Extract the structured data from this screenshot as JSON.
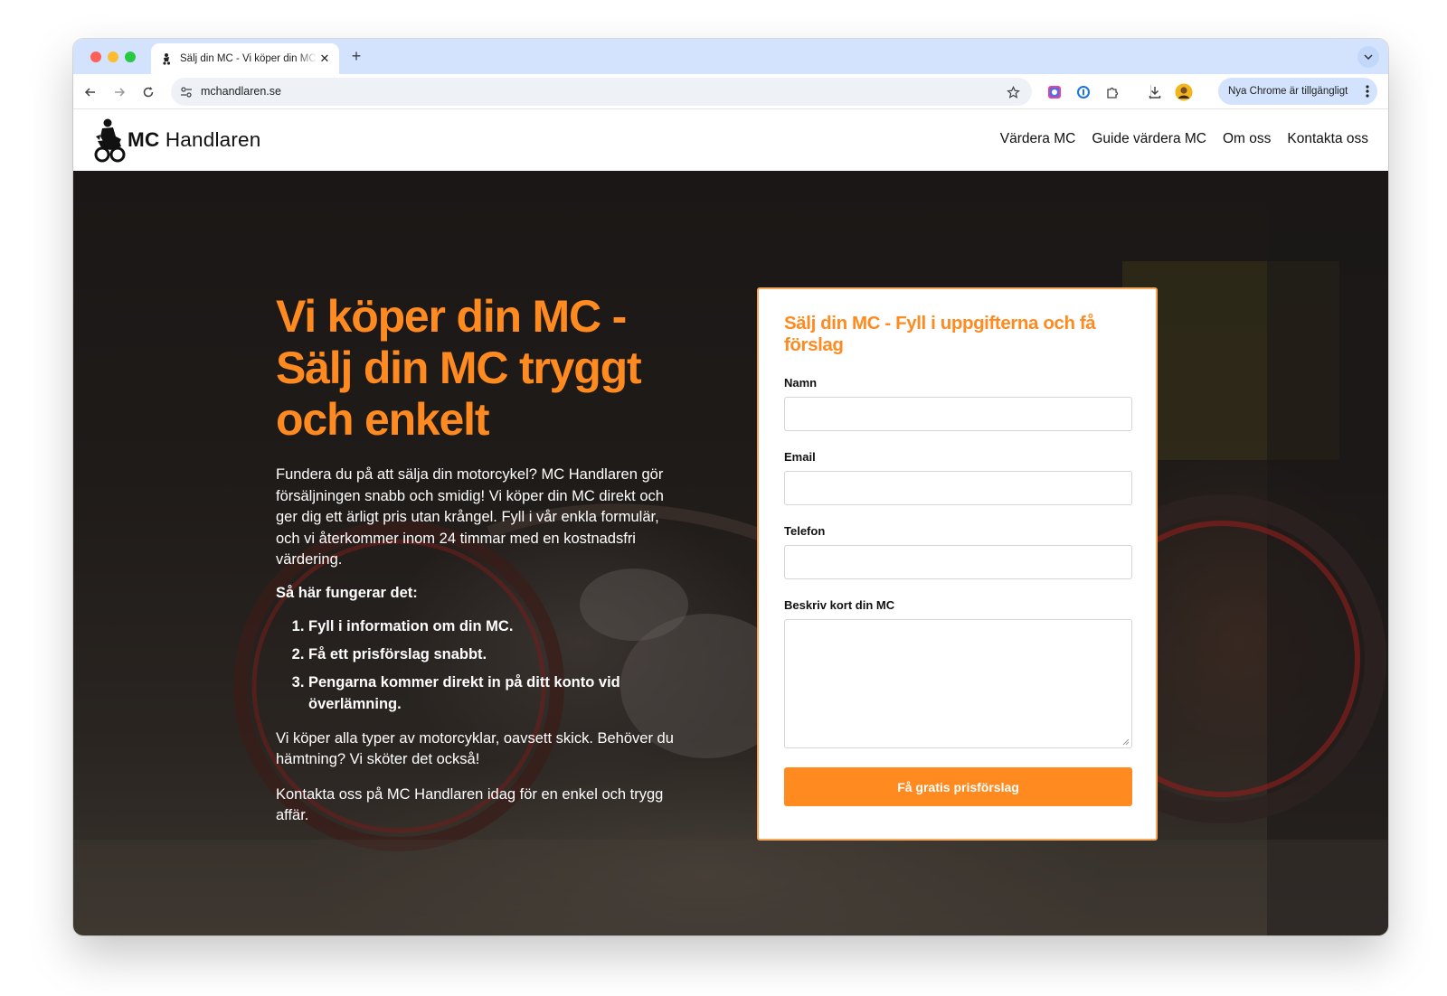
{
  "browser": {
    "tab_title": "Sälj din MC - Vi köper din MC",
    "url": "mchandlaren.se",
    "update_label": "Nya Chrome är tillgängligt"
  },
  "site": {
    "logo_bold": "MC",
    "logo_light": "Handlaren",
    "nav": [
      "Värdera MC",
      "Guide värdera MC",
      "Om oss",
      "Kontakta oss"
    ]
  },
  "hero": {
    "title_lines": [
      "Vi köper din MC -",
      "Sälj din MC tryggt",
      "och enkelt"
    ],
    "intro": "Fundera du på att sälja din motorcykel? MC Handlaren gör försäljningen snabb och smidig! Vi köper din MC direkt och ger dig ett ärligt pris utan krångel. Fyll i vår enkla formulär, och vi återkommer inom 24 timmar med en kostnadsfri värdering.",
    "how_title": "Så här fungerar det:",
    "steps": [
      "Fyll i information om din MC.",
      "Få ett prisförslag snabbt.",
      "Pengarna kommer direkt in på ditt konto vid överlämning."
    ],
    "para1": "Vi köper alla typer av motorcyklar, oavsett skick. Behöver du hämtning? Vi sköter det också!",
    "para2": "Kontakta oss på MC Handlaren idag för en enkel och trygg affär."
  },
  "form": {
    "title": "Sälj din MC - Fyll i uppgifterna och få förslag",
    "name_label": "Namn",
    "email_label": "Email",
    "phone_label": "Telefon",
    "desc_label": "Beskriv kort din MC",
    "submit_label": "Få gratis prisförslag"
  },
  "colors": {
    "accent": "#ff8a1f",
    "tabstrip": "#d3e3fd"
  }
}
